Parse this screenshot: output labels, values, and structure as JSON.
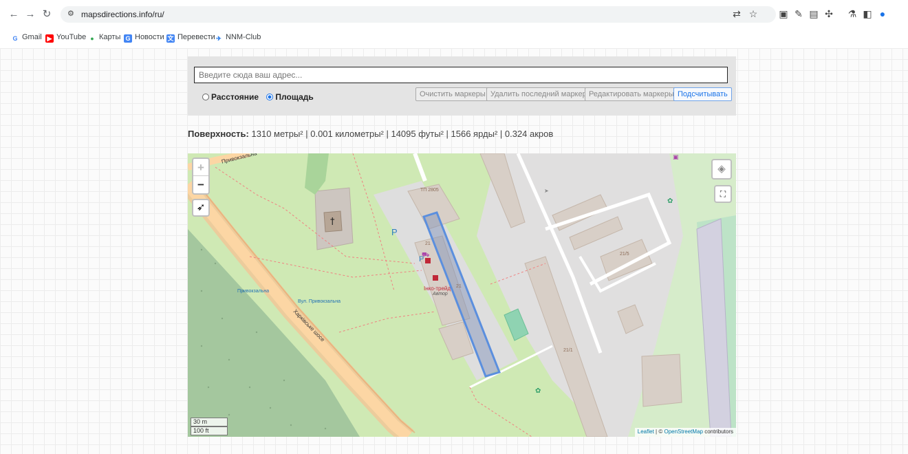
{
  "browser": {
    "url": "mapsdirections.info/ru/",
    "bookmarks": [
      {
        "label": "Gmail",
        "icon": "gmail-icon"
      },
      {
        "label": "YouTube",
        "icon": "youtube-icon"
      },
      {
        "label": "Карты",
        "icon": "maps-icon"
      },
      {
        "label": "Новости",
        "icon": "news-icon"
      },
      {
        "label": "Перевести",
        "icon": "translate-icon"
      },
      {
        "label": "NNM-Club",
        "icon": "nnm-icon"
      }
    ]
  },
  "controls": {
    "address_placeholder": "Введите сюда ваш адрес...",
    "mode_distance": "Расстояние",
    "mode_area": "Площадь",
    "selected_mode": "Площадь",
    "buttons": {
      "clear": "Очистить маркеры",
      "remove_last": "Удалить последний маркер",
      "edit": "Редактировать маркеры",
      "calculate": "Подсчитывать"
    }
  },
  "result": {
    "label": "Поверхность:",
    "text": "1310 метры² | 0.001 километры² | 14095 футы² | 1566 ярды² | 0.324 акров"
  },
  "map": {
    "labels": {
      "road": "Харківське шосе",
      "road2": "Привокзальна",
      "bus1": "Привокзальна",
      "bus2": "Вул. Привокзальна",
      "shop": "Інко-трейд",
      "shop_sub": "Автор",
      "b1": "ТП 2805",
      "b2": "21",
      "b3": "21",
      "b4": "21/5",
      "b5": "21/1",
      "parking": "P"
    },
    "scale_m": "30 m",
    "scale_ft": "100 ft",
    "attribution_leaflet": "Leaflet",
    "attribution_sep": "| ©",
    "attribution_osm": "OpenStreetMap",
    "attribution_tail": "contributors",
    "zoom_in": "+",
    "zoom_out": "−"
  }
}
